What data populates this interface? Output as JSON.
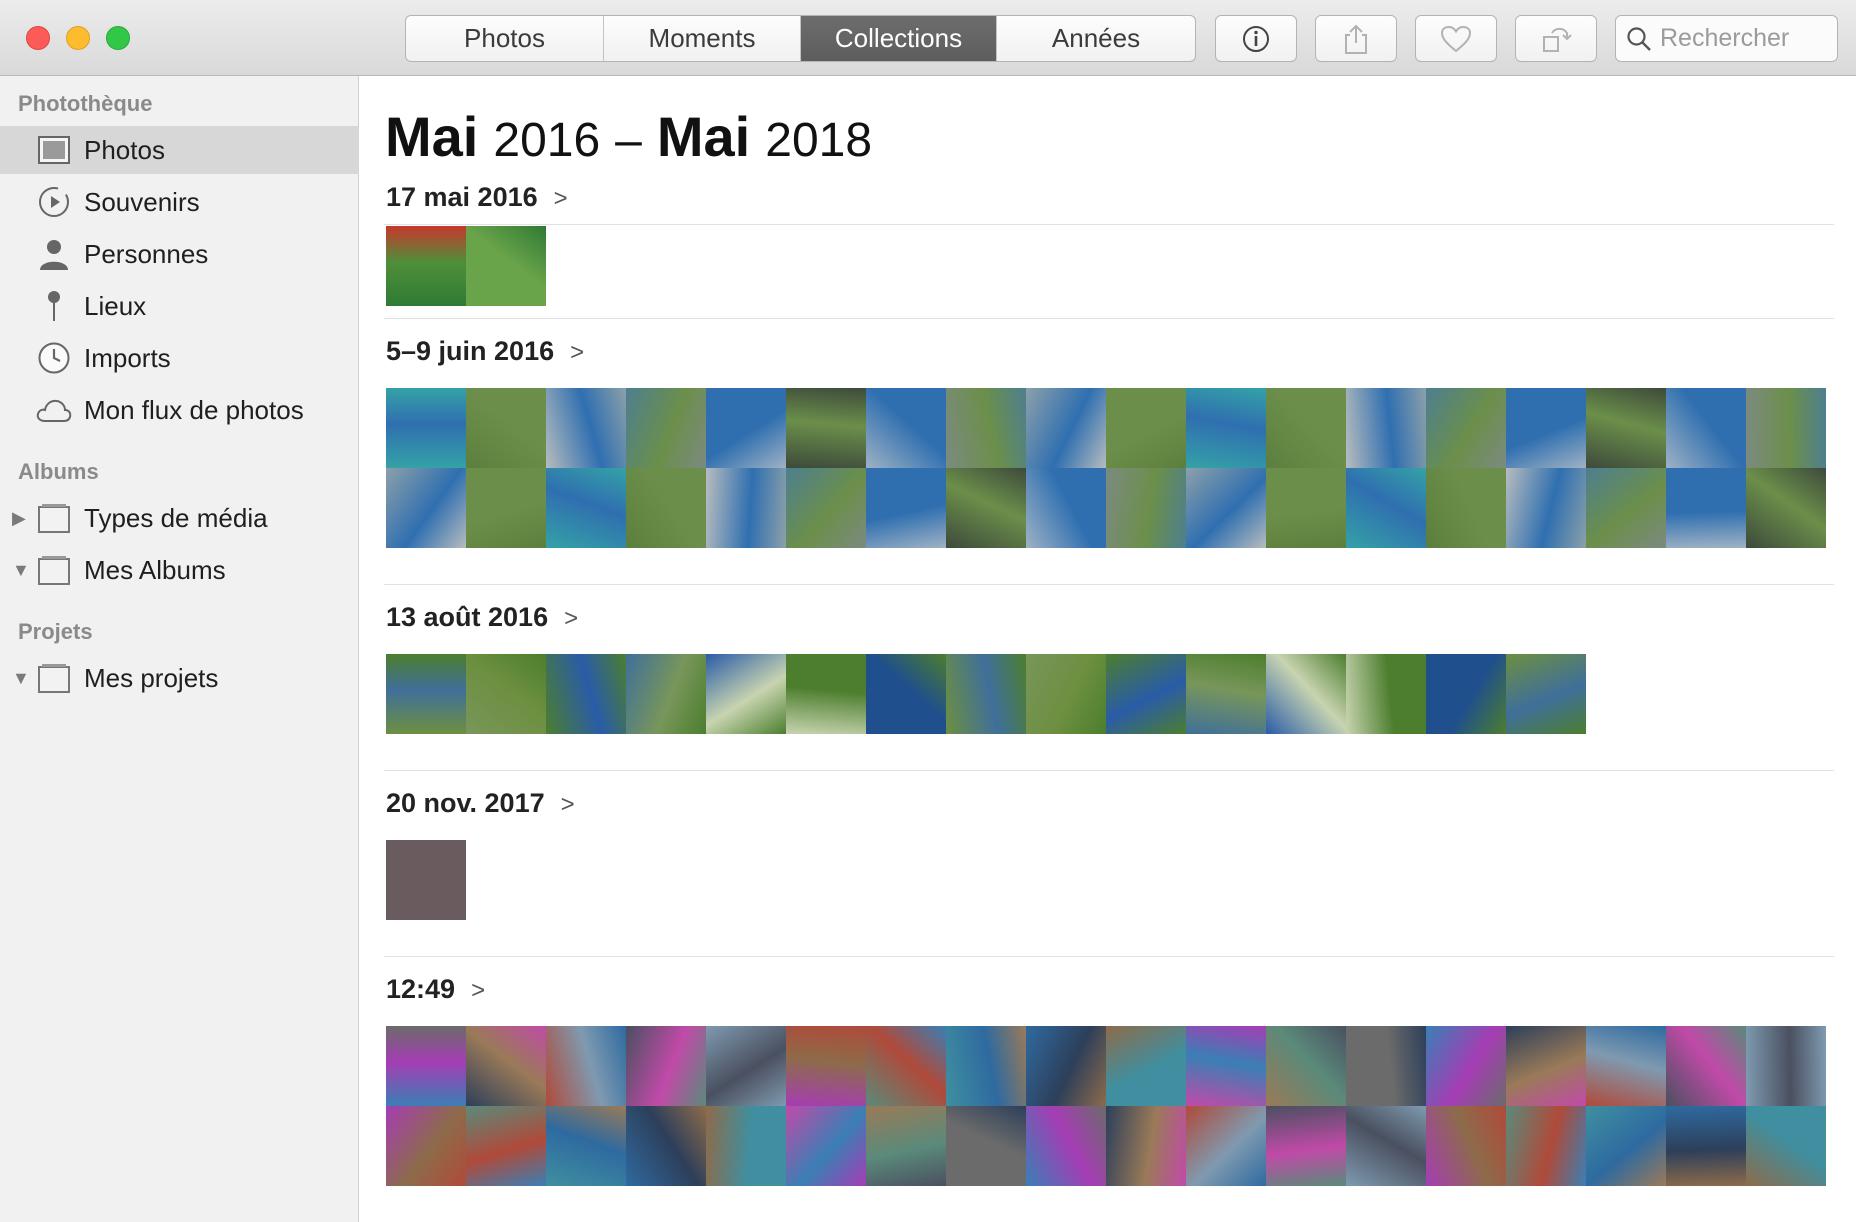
{
  "toolbar": {
    "tabs": [
      {
        "label": "Photos",
        "active": false
      },
      {
        "label": "Moments",
        "active": false
      },
      {
        "label": "Collections",
        "active": true
      },
      {
        "label": "Années",
        "active": false
      }
    ],
    "buttons": {
      "info": "info-icon",
      "share": "share-icon",
      "favorite": "heart-icon",
      "rotate": "rotate-icon"
    },
    "search": {
      "placeholder": "Rechercher"
    }
  },
  "sidebar": {
    "library_header": "Photothèque",
    "library_items": [
      {
        "label": "Photos",
        "icon": "photos-icon",
        "selected": true
      },
      {
        "label": "Souvenirs",
        "icon": "memories-icon"
      },
      {
        "label": "Personnes",
        "icon": "person-icon"
      },
      {
        "label": "Lieux",
        "icon": "pin-icon"
      },
      {
        "label": "Imports",
        "icon": "clock-icon"
      },
      {
        "label": "Mon flux de photos",
        "icon": "cloud-icon"
      }
    ],
    "albums_header": "Albums",
    "albums_items": [
      {
        "label": "Types de média",
        "icon": "folder-icon",
        "expanded": false
      },
      {
        "label": "Mes Albums",
        "icon": "folder-icon",
        "expanded": true
      }
    ],
    "projects_header": "Projets",
    "projects_items": [
      {
        "label": "Mes projets",
        "icon": "folder-icon",
        "expanded": true
      }
    ]
  },
  "main": {
    "title": {
      "month1": "Mai",
      "year1": "2016",
      "sep": "–",
      "month2": "Mai",
      "year2": "2018"
    },
    "sections": [
      {
        "header": "17 mai 2016",
        "photo_count": 2,
        "palette": [
          "#2f7a34",
          "#c8372c",
          "#4f8f3a",
          "#6aa44a"
        ]
      },
      {
        "header": "5–9 juin 2016",
        "photo_count": 36,
        "palette": [
          "#4d7f8f",
          "#34a2a6",
          "#7c8a80",
          "#2f6fb0",
          "#5d7f3e",
          "#8ca0aa",
          "#3d4a3b",
          "#b7bcbe",
          "#6b8f4a",
          "#9fb2c4"
        ]
      },
      {
        "header": "13 août 2016",
        "photo_count": 15,
        "palette": [
          "#2a5ca8",
          "#4c7e2e",
          "#6d8f40",
          "#c8d4b0",
          "#3f6f9a",
          "#78965a",
          "#1f4f8c"
        ]
      },
      {
        "header": "20 nov. 2017",
        "photo_count": 1,
        "palette": [
          "#3c4566",
          "#6a5c5e"
        ]
      },
      {
        "header": "12:49",
        "photo_count": 36,
        "palette": [
          "#4a5060",
          "#6b6b6b",
          "#2e6aa0",
          "#7f9ab0",
          "#3a7fb5",
          "#8d6b4a",
          "#a53db4",
          "#2d3f5a",
          "#c14aa8",
          "#5a8a7a",
          "#b04a3a",
          "#9a7a58",
          "#3f8fa0"
        ]
      }
    ]
  }
}
